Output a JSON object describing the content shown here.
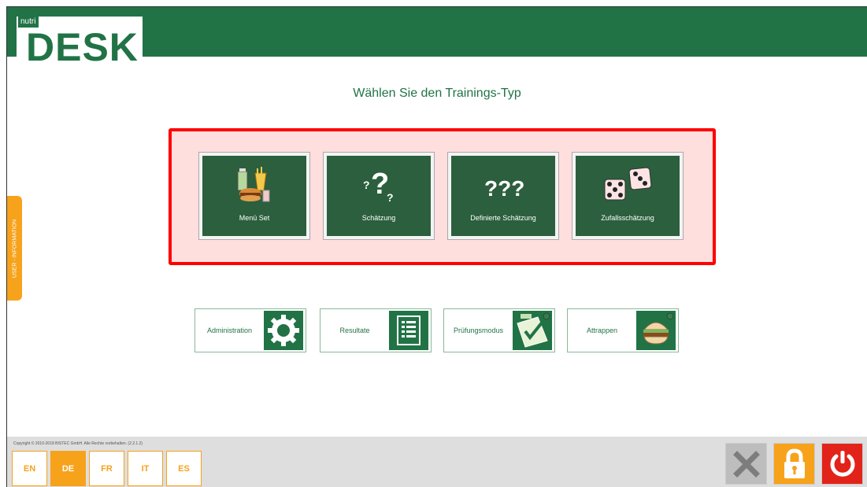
{
  "header": {
    "logo_small": "nutri",
    "logo_main": "DESK"
  },
  "main": {
    "title": "Wählen Sie den Trainings-Typ",
    "tiles": [
      {
        "label": "Menü Set",
        "icon": "food-menu-icon"
      },
      {
        "label": "Schätzung",
        "icon": "question-mark-icon"
      },
      {
        "label": "Definierte Schätzung",
        "icon": "triple-question-icon"
      },
      {
        "label": "Zufallsschätzung",
        "icon": "dice-icon"
      }
    ],
    "admin_buttons": [
      {
        "label": "Administration",
        "icon": "gear-icon"
      },
      {
        "label": "Resultate",
        "icon": "list-icon"
      },
      {
        "label": "Prüfungsmodus",
        "icon": "checklist-icon"
      },
      {
        "label": "Attrappen",
        "icon": "burger-icon"
      }
    ]
  },
  "sidebar": {
    "tab_label": "USER - INFORMATION"
  },
  "footer": {
    "copyright": "Copyright © 2010-2018 BISTEC GmbH. Alle Rechte vorbehalten. (2.2.1.2)",
    "languages": [
      "EN",
      "DE",
      "FR",
      "IT",
      "ES"
    ],
    "active_language": "DE",
    "controls": [
      {
        "name": "close",
        "icon": "close-icon"
      },
      {
        "name": "lock",
        "icon": "lock-icon"
      },
      {
        "name": "power",
        "icon": "power-icon"
      }
    ]
  },
  "colors": {
    "brand_green": "#217346",
    "tile_green": "#2b5f3d",
    "highlight_red": "#ff0000",
    "accent_orange": "#f7a21b",
    "power_red": "#e2231a"
  }
}
